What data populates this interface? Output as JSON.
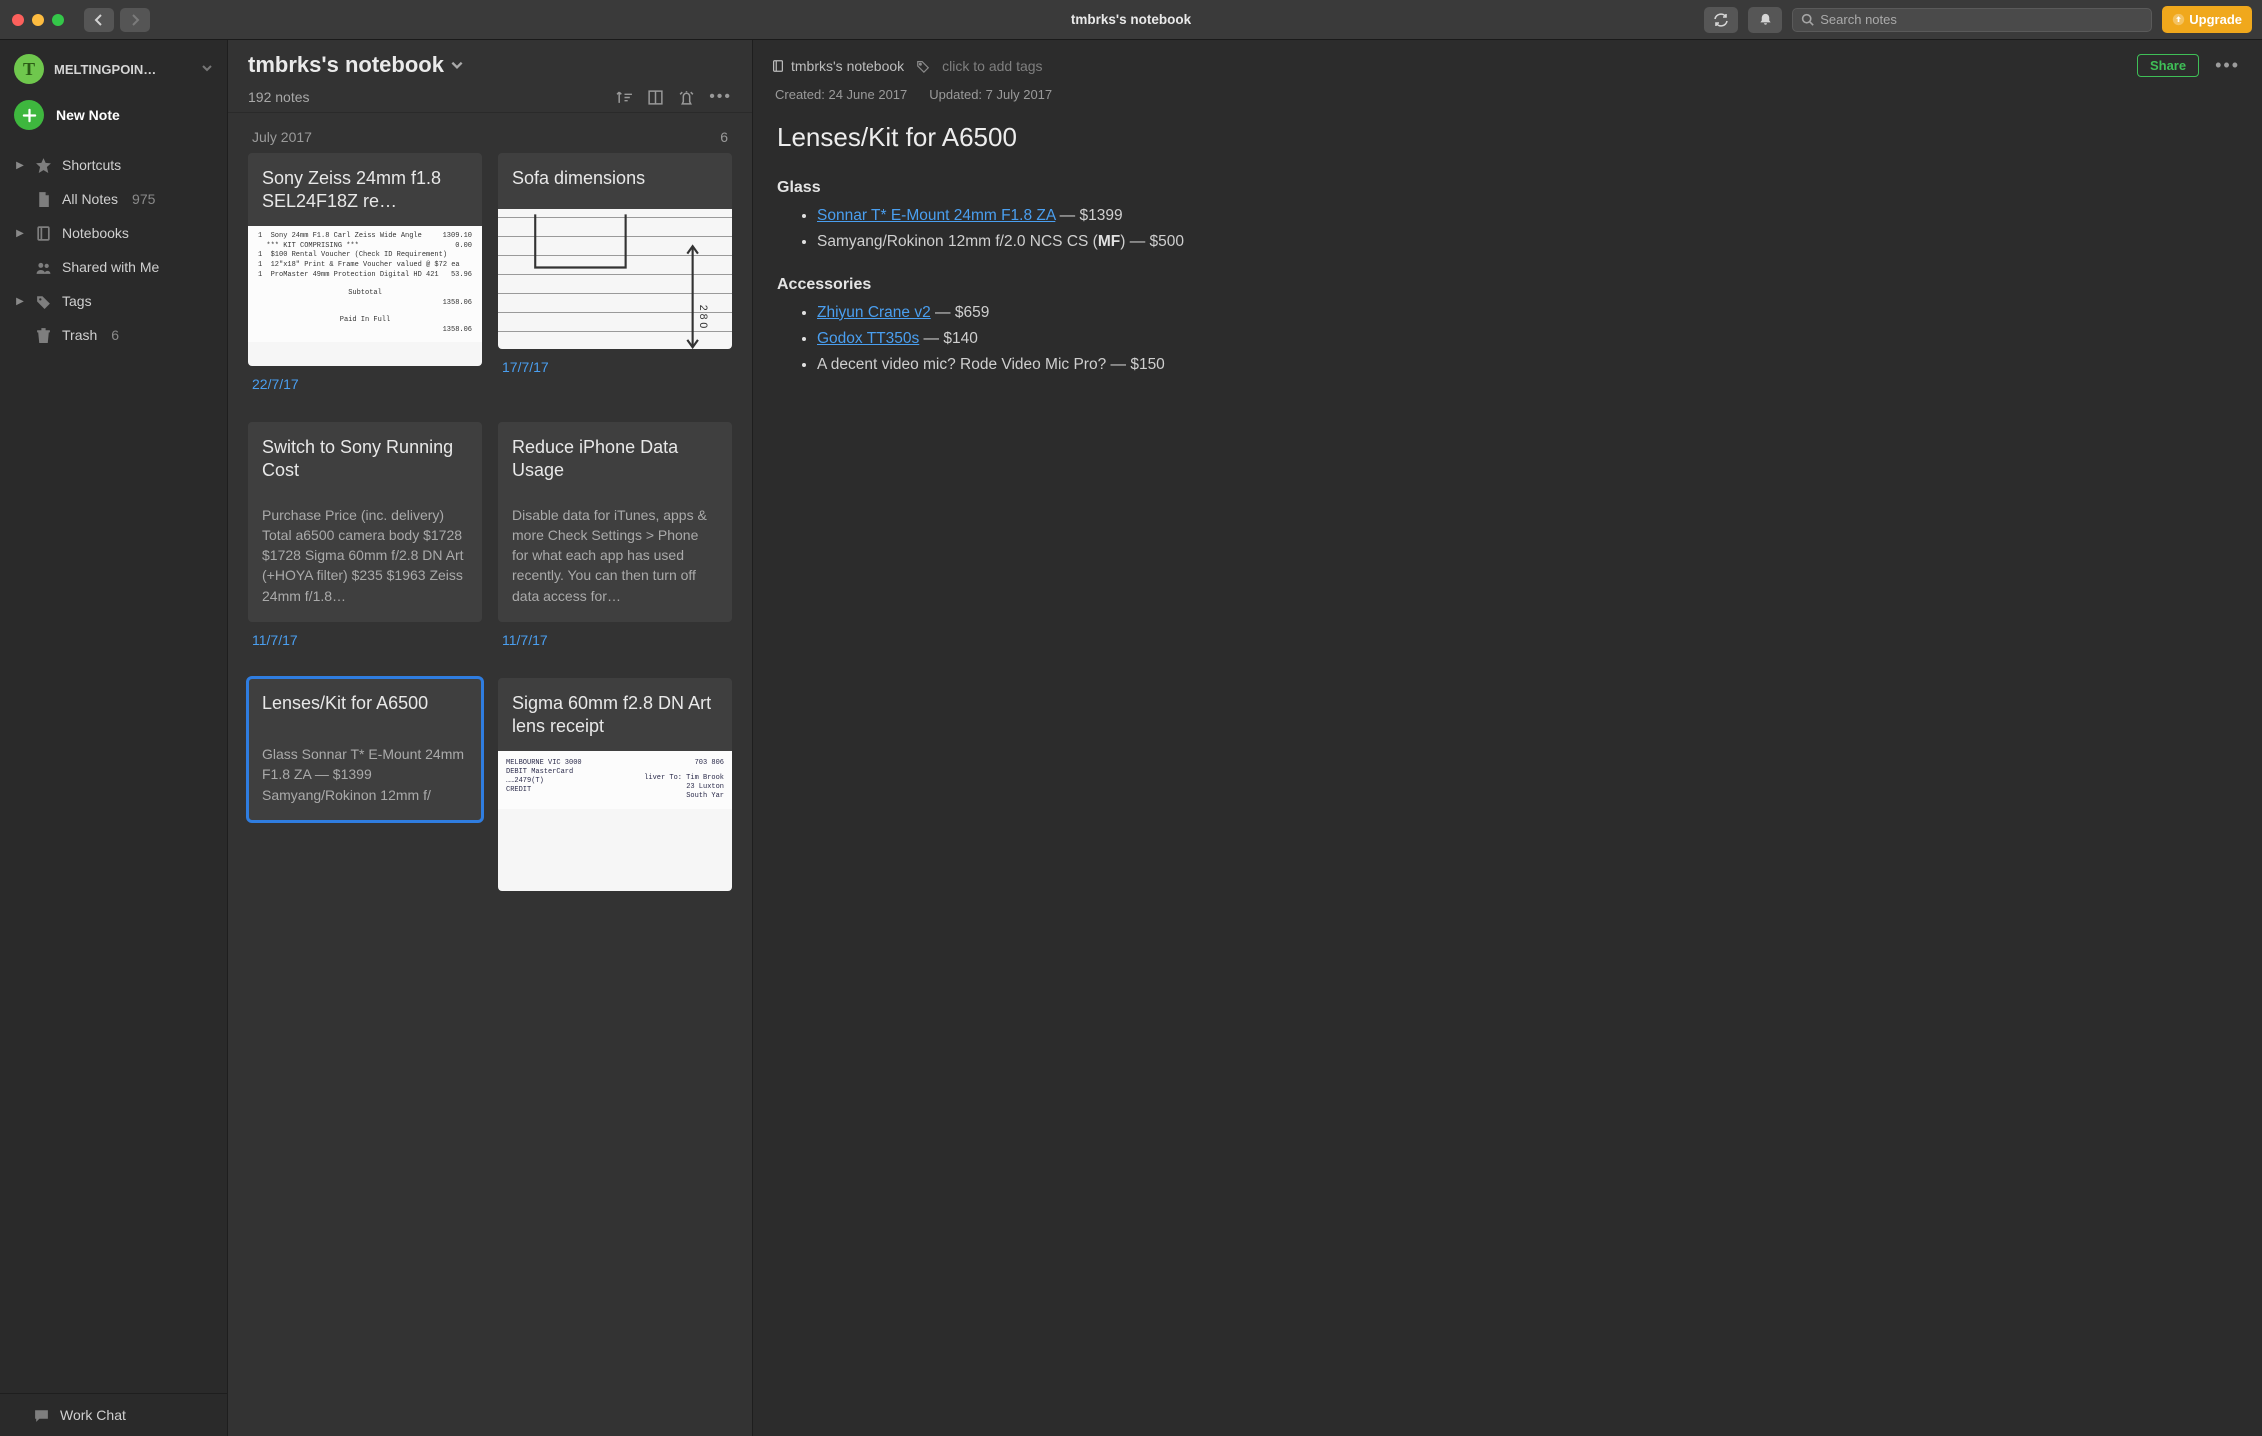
{
  "window_title": "tmbrks's notebook",
  "search_placeholder": "Search notes",
  "upgrade_label": "Upgrade",
  "account": {
    "name": "MELTINGPOIN…",
    "initial": "T"
  },
  "new_note_label": "New Note",
  "sidebar": {
    "items": [
      {
        "label": "Shortcuts",
        "icon": "star",
        "expandable": true
      },
      {
        "label": "All Notes",
        "icon": "note",
        "count": "975"
      },
      {
        "label": "Notebooks",
        "icon": "book",
        "expandable": true
      },
      {
        "label": "Shared with Me",
        "icon": "people"
      },
      {
        "label": "Tags",
        "icon": "tag",
        "expandable": true
      },
      {
        "label": "Trash",
        "icon": "trash",
        "count": "6"
      }
    ],
    "footer": {
      "label": "Work Chat",
      "icon": "chat"
    }
  },
  "list": {
    "title": "tmbrks's notebook",
    "count_label": "192 notes",
    "month_label": "July 2017",
    "month_count": "6",
    "cards": [
      {
        "title": "Sony Zeiss 24mm f1.8 SEL24F18Z re…",
        "date": "22/7/17",
        "thumb": "receipt1"
      },
      {
        "title": "Sofa dimensions",
        "date": "17/7/17",
        "thumb": "sketch"
      },
      {
        "title": "Switch to Sony Running Cost",
        "date": "11/7/17",
        "snippet": "Purchase Price (inc. delivery) Total a6500 camera body $1728 $1728 Sigma 60mm f/2.8 DN Art (+HOYA filter) $235 $1963 Zeiss 24mm f/1.8…"
      },
      {
        "title": "Reduce iPhone Data Usage",
        "date": "11/7/17",
        "snippet": "Disable data for iTunes, apps & more Check Settings > Phone for what each app has used recently. You can then turn off data access for…"
      },
      {
        "title": "Lenses/Kit for A6500",
        "selected": true,
        "snippet": "Glass Sonnar T* E-Mount 24mm F1.8 ZA — $1399 Samyang/Rokinon 12mm f/"
      },
      {
        "title": "Sigma 60mm f2.8 DN Art lens receipt",
        "thumb": "receipt2"
      }
    ],
    "thumbs": {
      "receipt1": {
        "lines": [
          [
            "1",
            "Sony 24mm F1.8 Carl Zeiss Wide Angle",
            "1309.10"
          ],
          [
            "",
            "*** KIT COMPRISING ***",
            "0.00"
          ],
          [
            "1",
            "$100 Rental Voucher (Check ID Requirement)",
            ""
          ],
          [
            "1",
            "12\"x18\" Print & Frame Voucher valued @ $72 ea",
            ""
          ],
          [
            "1",
            "ProMaster 49mm Protection Digital HD 421",
            "53.96"
          ]
        ],
        "subtotal_label": "Subtotal",
        "subtotal": "1358.06",
        "paid_label": "Paid In Full",
        "paid": "1358.06"
      },
      "receipt2": {
        "left_lines": [
          "MELBOURNE VIC 3000",
          "DEBIT MasterCard",
          "……2479(T)",
          "CREDIT"
        ],
        "top_right": "703 806",
        "right_lines": [
          "liver To: Tim Brook",
          "23 Luxton",
          "South Yar"
        ]
      }
    }
  },
  "editor": {
    "breadcrumb": "tmbrks's notebook",
    "add_tags_label": "click to add tags",
    "share_label": "Share",
    "created_label": "Created: 24 June 2017",
    "updated_label": "Updated: 7 July 2017",
    "note_title": "Lenses/Kit for A6500",
    "sections": {
      "glass": {
        "heading": "Glass",
        "items": [
          {
            "link": "Sonnar T* E-Mount 24mm F1.8 ZA",
            "rest": " — $1399"
          },
          {
            "prefix": "Samyang/Rokinon 12mm f/2.0 NCS CS (",
            "bold": "MF",
            "suffix": ") — $500"
          }
        ]
      },
      "accessories": {
        "heading": "Accessories",
        "items": [
          {
            "link": "Zhiyun Crane v2",
            "rest": " — $659"
          },
          {
            "link": "Godox TT350s",
            "rest": " — $140"
          },
          {
            "text": "A decent video mic? Rode Video Mic Pro? — $150"
          }
        ]
      }
    }
  }
}
